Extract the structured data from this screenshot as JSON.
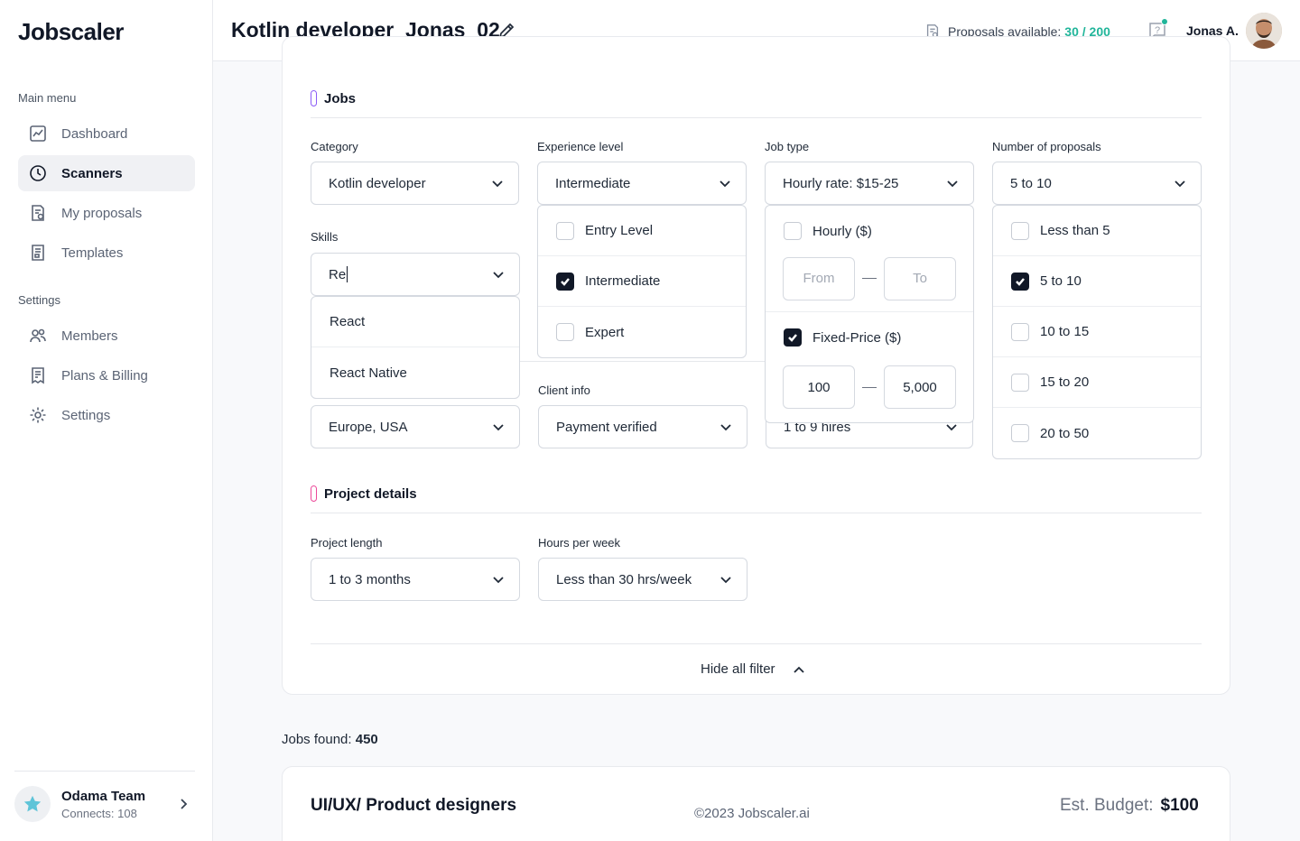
{
  "app": {
    "logo": "Jobscaler"
  },
  "sidebar": {
    "main_menu_title": "Main menu",
    "main_items": [
      {
        "label": "Dashboard",
        "icon": "chart-icon"
      },
      {
        "label": "Scanners",
        "icon": "clock-icon",
        "active": true
      },
      {
        "label": "My proposals",
        "icon": "proposal-icon"
      },
      {
        "label": "Templates",
        "icon": "template-icon"
      }
    ],
    "settings_title": "Settings",
    "settings_items": [
      {
        "label": "Members",
        "icon": "members-icon"
      },
      {
        "label": "Plans & Billing",
        "icon": "billing-icon"
      },
      {
        "label": "Settings",
        "icon": "gear-icon"
      }
    ],
    "team": {
      "name": "Odama Team",
      "connects": "Connects: 108"
    }
  },
  "header": {
    "title": "Kotlin developer_Jonas_02",
    "proposals_label": "Proposals available:",
    "proposals_count": "30 / 200",
    "user_name": "Jonas A."
  },
  "filters": {
    "jobs_section": "Jobs",
    "category": {
      "label": "Category",
      "value": "Kotlin developer"
    },
    "experience": {
      "label": "Experience level",
      "value": "Intermediate",
      "options": [
        {
          "label": "Entry Level",
          "checked": false
        },
        {
          "label": "Intermediate",
          "checked": true
        },
        {
          "label": "Expert",
          "checked": false
        }
      ]
    },
    "job_type": {
      "label": "Job type",
      "value": "Hourly rate: $15-25",
      "hourly_label": "Hourly ($)",
      "hourly_checked": false,
      "hourly_from_placeholder": "From",
      "hourly_to_placeholder": "To",
      "fixed_label": "Fixed-Price ($)",
      "fixed_checked": true,
      "fixed_from": "100",
      "fixed_to": "5,000"
    },
    "num_proposals": {
      "label": "Number of proposals",
      "value": "5 to 10",
      "options": [
        {
          "label": "Less than 5",
          "checked": false
        },
        {
          "label": "5 to 10",
          "checked": true
        },
        {
          "label": "10 to 15",
          "checked": false
        },
        {
          "label": "15 to 20",
          "checked": false
        },
        {
          "label": "20 to 50",
          "checked": false
        }
      ]
    },
    "skills": {
      "label": "Skills",
      "input_value": "Re",
      "suggestions": [
        "React",
        "React Native"
      ]
    },
    "location": {
      "value": "Europe, USA"
    },
    "client_info": {
      "label": "Client info",
      "value": "Payment verified"
    },
    "client_hires": {
      "value": "1 to 9 hires"
    },
    "project_section": "Project details",
    "project_length": {
      "label": "Project length",
      "value": "1 to 3 months"
    },
    "hours_per_week": {
      "label": "Hours per week",
      "value": "Less than 30 hrs/week"
    },
    "hide_all": "Hide all filter"
  },
  "results": {
    "jobs_found_label": "Jobs found:",
    "jobs_found_count": "450",
    "first_job_title": "UI/UX/ Product designers",
    "budget_label": "Est. Budget:",
    "budget_value": "$100"
  },
  "footer": {
    "copyright": "©2023 Jobscaler.ai"
  },
  "colors": {
    "accent": "#21b59a",
    "check": "#111827",
    "jobs_pill": "#8b5cf6",
    "project_pill": "#ec4899"
  }
}
